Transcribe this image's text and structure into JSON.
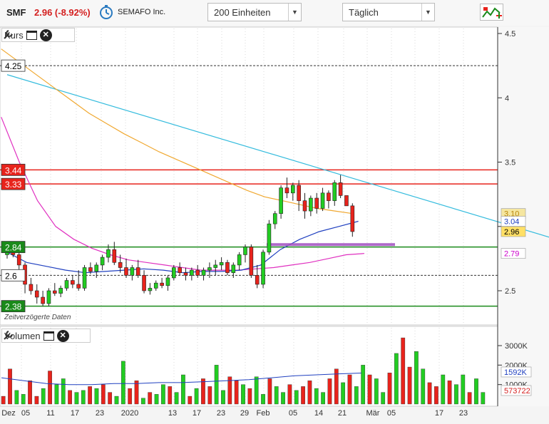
{
  "header": {
    "symbol": "SMF",
    "price_change": "2.96 (-8.92%)",
    "company": "SEMAFO Inc.",
    "range_select": "200 Einheiten",
    "interval_select": "Täglich"
  },
  "price_panel": {
    "label": "Kurs",
    "delay_note": "Zeitverzögerte Daten",
    "y_ticks": [
      "4.5",
      "4",
      "3.5",
      "3",
      "2.5"
    ],
    "left_markers": [
      {
        "text": "4.25",
        "value": 4.25,
        "bg": "#ffffff",
        "fg": "#000000"
      },
      {
        "text": "3.44",
        "value": 3.44,
        "bg": "#e8231c",
        "fg": "#ffffff"
      },
      {
        "text": "3.33",
        "value": 3.33,
        "bg": "#e8231c",
        "fg": "#ffffff"
      },
      {
        "text": "2.84",
        "value": 2.84,
        "bg": "#1a8a1a",
        "fg": "#ffffff"
      },
      {
        "text": "2.6",
        "value": 2.62,
        "bg": "#ffffff",
        "fg": "#000000"
      },
      {
        "text": "2.38",
        "value": 2.38,
        "bg": "#1a8a1a",
        "fg": "#ffffff"
      }
    ],
    "right_markers": [
      {
        "text": "3.10",
        "value": 3.1,
        "bg": "#f5e6a0",
        "fg": "#b8860b"
      },
      {
        "text": "3.04",
        "value": 3.04,
        "bg": "#ffffff",
        "fg": "#1f3fbf"
      },
      {
        "text": "2.96",
        "value": 2.96,
        "bg": "#ffe066",
        "fg": "#000000"
      },
      {
        "text": "2.79",
        "value": 2.79,
        "bg": "#ffffff",
        "fg": "#cc00cc"
      }
    ]
  },
  "volume_panel": {
    "label": "Volumen",
    "y_ticks": [
      "3000K",
      "2000K",
      "1000K"
    ],
    "right_markers": [
      {
        "text": "1592K",
        "value": 1592,
        "fg": "#1f3fbf",
        "bg": "#ffffff"
      },
      {
        "text": "573722",
        "value": 574,
        "fg": "#d42020",
        "bg": "#ffffff"
      }
    ]
  },
  "x_labels": [
    "Dez",
    "05",
    "11",
    "17",
    "23",
    "2020",
    "13",
    "17",
    "23",
    "29",
    "Feb",
    "05",
    "14",
    "21",
    "Mär",
    "05",
    "17",
    "23"
  ],
  "chart_data": {
    "type": "candlestick",
    "ylim": [
      2.35,
      4.5
    ],
    "volume_ylim": [
      0,
      3500
    ],
    "horizontal_levels": [
      {
        "value": 4.25,
        "color": "#333333",
        "style": "dashed"
      },
      {
        "value": 3.44,
        "color": "#e8231c",
        "style": "solid"
      },
      {
        "value": 3.33,
        "color": "#e8231c",
        "style": "solid"
      },
      {
        "value": 2.84,
        "color": "#1a8a1a",
        "style": "solid"
      },
      {
        "value": 2.62,
        "color": "#333333",
        "style": "dashed"
      },
      {
        "value": 2.38,
        "color": "#1a8a1a",
        "style": "solid"
      }
    ],
    "bullish_color": "#22cc22",
    "bearish_color": "#e8231c",
    "ohlc": [
      [
        2.78,
        2.82,
        2.75,
        2.8
      ],
      [
        2.8,
        2.82,
        2.76,
        2.78
      ],
      [
        2.78,
        2.82,
        2.65,
        2.7
      ],
      [
        2.7,
        2.72,
        2.48,
        2.55
      ],
      [
        2.55,
        2.6,
        2.47,
        2.5
      ],
      [
        2.5,
        2.55,
        2.4,
        2.45
      ],
      [
        2.45,
        2.5,
        2.38,
        2.4
      ],
      [
        2.4,
        2.52,
        2.38,
        2.5
      ],
      [
        2.5,
        2.56,
        2.46,
        2.48
      ],
      [
        2.48,
        2.54,
        2.45,
        2.52
      ],
      [
        2.52,
        2.6,
        2.5,
        2.58
      ],
      [
        2.58,
        2.62,
        2.52,
        2.55
      ],
      [
        2.55,
        2.66,
        2.5,
        2.52
      ],
      [
        2.52,
        2.7,
        2.5,
        2.68
      ],
      [
        2.68,
        2.72,
        2.63,
        2.65
      ],
      [
        2.65,
        2.72,
        2.6,
        2.7
      ],
      [
        2.7,
        2.78,
        2.66,
        2.76
      ],
      [
        2.76,
        2.86,
        2.72,
        2.82
      ],
      [
        2.82,
        2.88,
        2.7,
        2.72
      ],
      [
        2.72,
        2.78,
        2.64,
        2.68
      ],
      [
        2.68,
        2.75,
        2.6,
        2.62
      ],
      [
        2.62,
        2.7,
        2.58,
        2.68
      ],
      [
        2.68,
        2.74,
        2.6,
        2.62
      ],
      [
        2.62,
        2.66,
        2.48,
        2.5
      ],
      [
        2.5,
        2.56,
        2.47,
        2.52
      ],
      [
        2.52,
        2.58,
        2.5,
        2.56
      ],
      [
        2.56,
        2.6,
        2.52,
        2.54
      ],
      [
        2.54,
        2.62,
        2.5,
        2.6
      ],
      [
        2.6,
        2.7,
        2.58,
        2.68
      ],
      [
        2.68,
        2.72,
        2.62,
        2.64
      ],
      [
        2.64,
        2.68,
        2.58,
        2.62
      ],
      [
        2.62,
        2.68,
        2.58,
        2.66
      ],
      [
        2.66,
        2.7,
        2.6,
        2.62
      ],
      [
        2.62,
        2.68,
        2.58,
        2.66
      ],
      [
        2.66,
        2.72,
        2.6,
        2.68
      ],
      [
        2.68,
        2.74,
        2.62,
        2.7
      ],
      [
        2.7,
        2.76,
        2.66,
        2.72
      ],
      [
        2.72,
        2.74,
        2.62,
        2.64
      ],
      [
        2.64,
        2.72,
        2.6,
        2.7
      ],
      [
        2.7,
        2.8,
        2.66,
        2.78
      ],
      [
        2.78,
        2.86,
        2.72,
        2.84
      ],
      [
        2.84,
        2.86,
        2.6,
        2.62
      ],
      [
        2.62,
        2.7,
        2.52,
        2.55
      ],
      [
        2.55,
        2.82,
        2.52,
        2.8
      ],
      [
        2.8,
        3.05,
        2.78,
        3.02
      ],
      [
        3.02,
        3.12,
        2.98,
        3.1
      ],
      [
        3.1,
        3.32,
        3.06,
        3.3
      ],
      [
        3.3,
        3.38,
        3.22,
        3.26
      ],
      [
        3.26,
        3.34,
        3.2,
        3.32
      ],
      [
        3.32,
        3.36,
        3.12,
        3.2
      ],
      [
        3.2,
        3.26,
        3.06,
        3.12
      ],
      [
        3.12,
        3.24,
        3.08,
        3.22
      ],
      [
        3.22,
        3.26,
        3.1,
        3.14
      ],
      [
        3.14,
        3.3,
        3.12,
        3.26
      ],
      [
        3.26,
        3.28,
        3.14,
        3.2
      ],
      [
        3.2,
        3.36,
        3.16,
        3.34
      ],
      [
        3.34,
        3.4,
        3.22,
        3.24
      ],
      [
        3.24,
        3.16,
        3.18,
        3.16
      ],
      [
        3.16,
        3.18,
        2.92,
        2.96
      ]
    ],
    "volume": [
      400,
      1800,
      700,
      500,
      1200,
      400,
      800,
      1700,
      1000,
      1300,
      700,
      600,
      700,
      900,
      800,
      1000,
      600,
      400,
      2200,
      800,
      1200,
      300,
      600,
      500,
      1000,
      900,
      600,
      1500,
      400,
      800,
      1300,
      900,
      2000,
      700,
      1400,
      1200,
      1000,
      800,
      1400,
      500,
      1300,
      900,
      600,
      1000,
      700,
      900,
      1200,
      800,
      600,
      1300,
      1800,
      1100,
      1500,
      900,
      2000,
      1500,
      1300,
      600,
      1600,
      2600,
      3400,
      1900,
      2700,
      1800,
      1100,
      900,
      1500,
      1200,
      1000,
      1500,
      600,
      1300,
      600
    ],
    "ma_slow": [
      4.38,
      4.28,
      4.18,
      4.08,
      3.98,
      3.88,
      3.8,
      3.72,
      3.65,
      3.58,
      3.52,
      3.46,
      3.4,
      3.34,
      3.28,
      3.23,
      3.2,
      3.17,
      3.14,
      3.12,
      3.1
    ],
    "ma_mid": [
      3.85,
      3.5,
      3.2,
      3.0,
      2.9,
      2.83,
      2.78,
      2.74,
      2.72,
      2.7,
      2.68,
      2.66,
      2.66,
      2.66,
      2.67,
      2.68,
      2.7,
      2.72,
      2.75,
      2.78,
      2.79
    ],
    "ma_fast": [
      2.8,
      2.72,
      2.69,
      2.66,
      2.64,
      2.65,
      2.66,
      2.67,
      2.66,
      2.64,
      2.65,
      2.65,
      2.66,
      2.7,
      2.82,
      2.9,
      2.96,
      3.0,
      3.04
    ],
    "trendline": {
      "from": [
        0,
        4.18
      ],
      "to": [
        98,
        2.82
      ]
    },
    "vol_ma": [
      1350,
      1200,
      1050,
      1000,
      1000,
      1050,
      1050,
      1100,
      1100,
      1150,
      1200,
      1250,
      1350,
      1450,
      1500,
      1550,
      1592
    ]
  }
}
